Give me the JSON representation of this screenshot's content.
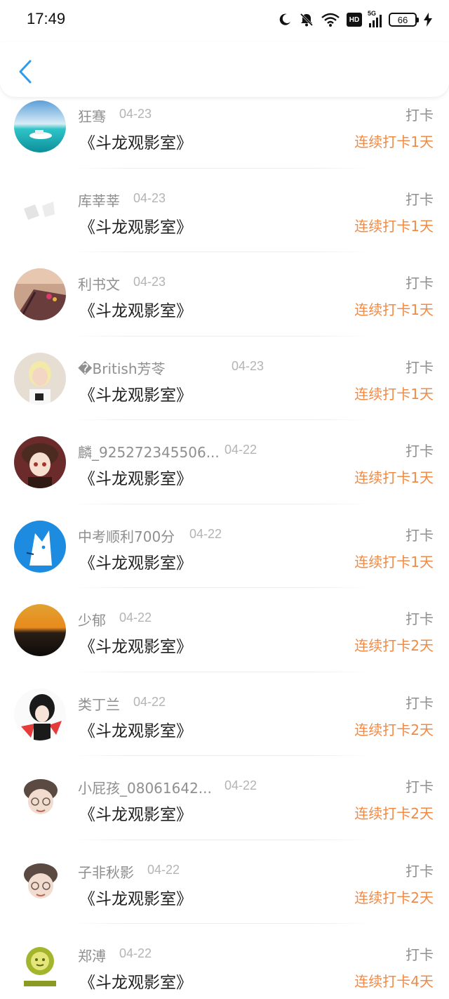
{
  "status_bar": {
    "time": "17:49",
    "network_label": "5G",
    "hd_label": "HD",
    "battery_level": "66",
    "icons": [
      "moon-icon",
      "bell-off-icon",
      "wifi-icon",
      "hd-icon",
      "signal-icon",
      "battery-icon",
      "charging-icon"
    ]
  },
  "header": {
    "back_icon": "chevron-left-icon",
    "accent_color": "#2f9be8"
  },
  "colors": {
    "streak": "#f08a44",
    "name": "#8f8f8f",
    "title": "#222222"
  },
  "records": [
    {
      "name": "狂骞",
      "date": "04-23",
      "title": "《斗龙观影室》",
      "type": "打卡",
      "streak": "连续打卡1天",
      "avatar": "sea-boat"
    },
    {
      "name": "库莘莘",
      "date": "04-23",
      "title": "《斗龙观影室》",
      "type": "打卡",
      "streak": "连续打卡1天",
      "avatar": "white-sketch"
    },
    {
      "name": "利书文",
      "date": "04-23",
      "title": "《斗龙观影室》",
      "type": "打卡",
      "streak": "连续打卡1天",
      "avatar": "dock-sunset"
    },
    {
      "name": "�British芳苓",
      "date": "04-23",
      "title": "《斗龙观影室》",
      "type": "打卡",
      "streak": "连续打卡1天",
      "avatar": "blond-person"
    },
    {
      "name": "麟_925272345506...",
      "date": "04-22",
      "title": "《斗龙观影室》",
      "type": "打卡",
      "streak": "连续打卡1天",
      "avatar": "anime-girl"
    },
    {
      "name": "中考顺利700分",
      "date": "04-22",
      "title": "《斗龙观影室》",
      "type": "打卡",
      "streak": "连续打卡1天",
      "avatar": "blue-cat"
    },
    {
      "name": "少郁",
      "date": "04-22",
      "title": "《斗龙观影室》",
      "type": "打卡",
      "streak": "连续打卡2天",
      "avatar": "sunset"
    },
    {
      "name": "类丁兰",
      "date": "04-22",
      "title": "《斗龙观影室》",
      "type": "打卡",
      "streak": "连续打卡2天",
      "avatar": "dark-hair-anime"
    },
    {
      "name": "小屁孩_08061642...",
      "date": "04-22",
      "title": "《斗龙观影室》",
      "type": "打卡",
      "streak": "连续打卡2天",
      "avatar": "sketch-boy"
    },
    {
      "name": "子非秋影",
      "date": "04-22",
      "title": "《斗龙观影室》",
      "type": "打卡",
      "streak": "连续打卡2天",
      "avatar": "sketch-boy"
    },
    {
      "name": "郑溥",
      "date": "04-22",
      "title": "《斗龙观影室》",
      "type": "打卡",
      "streak": "连续打卡4天",
      "avatar": "sun-god"
    }
  ]
}
